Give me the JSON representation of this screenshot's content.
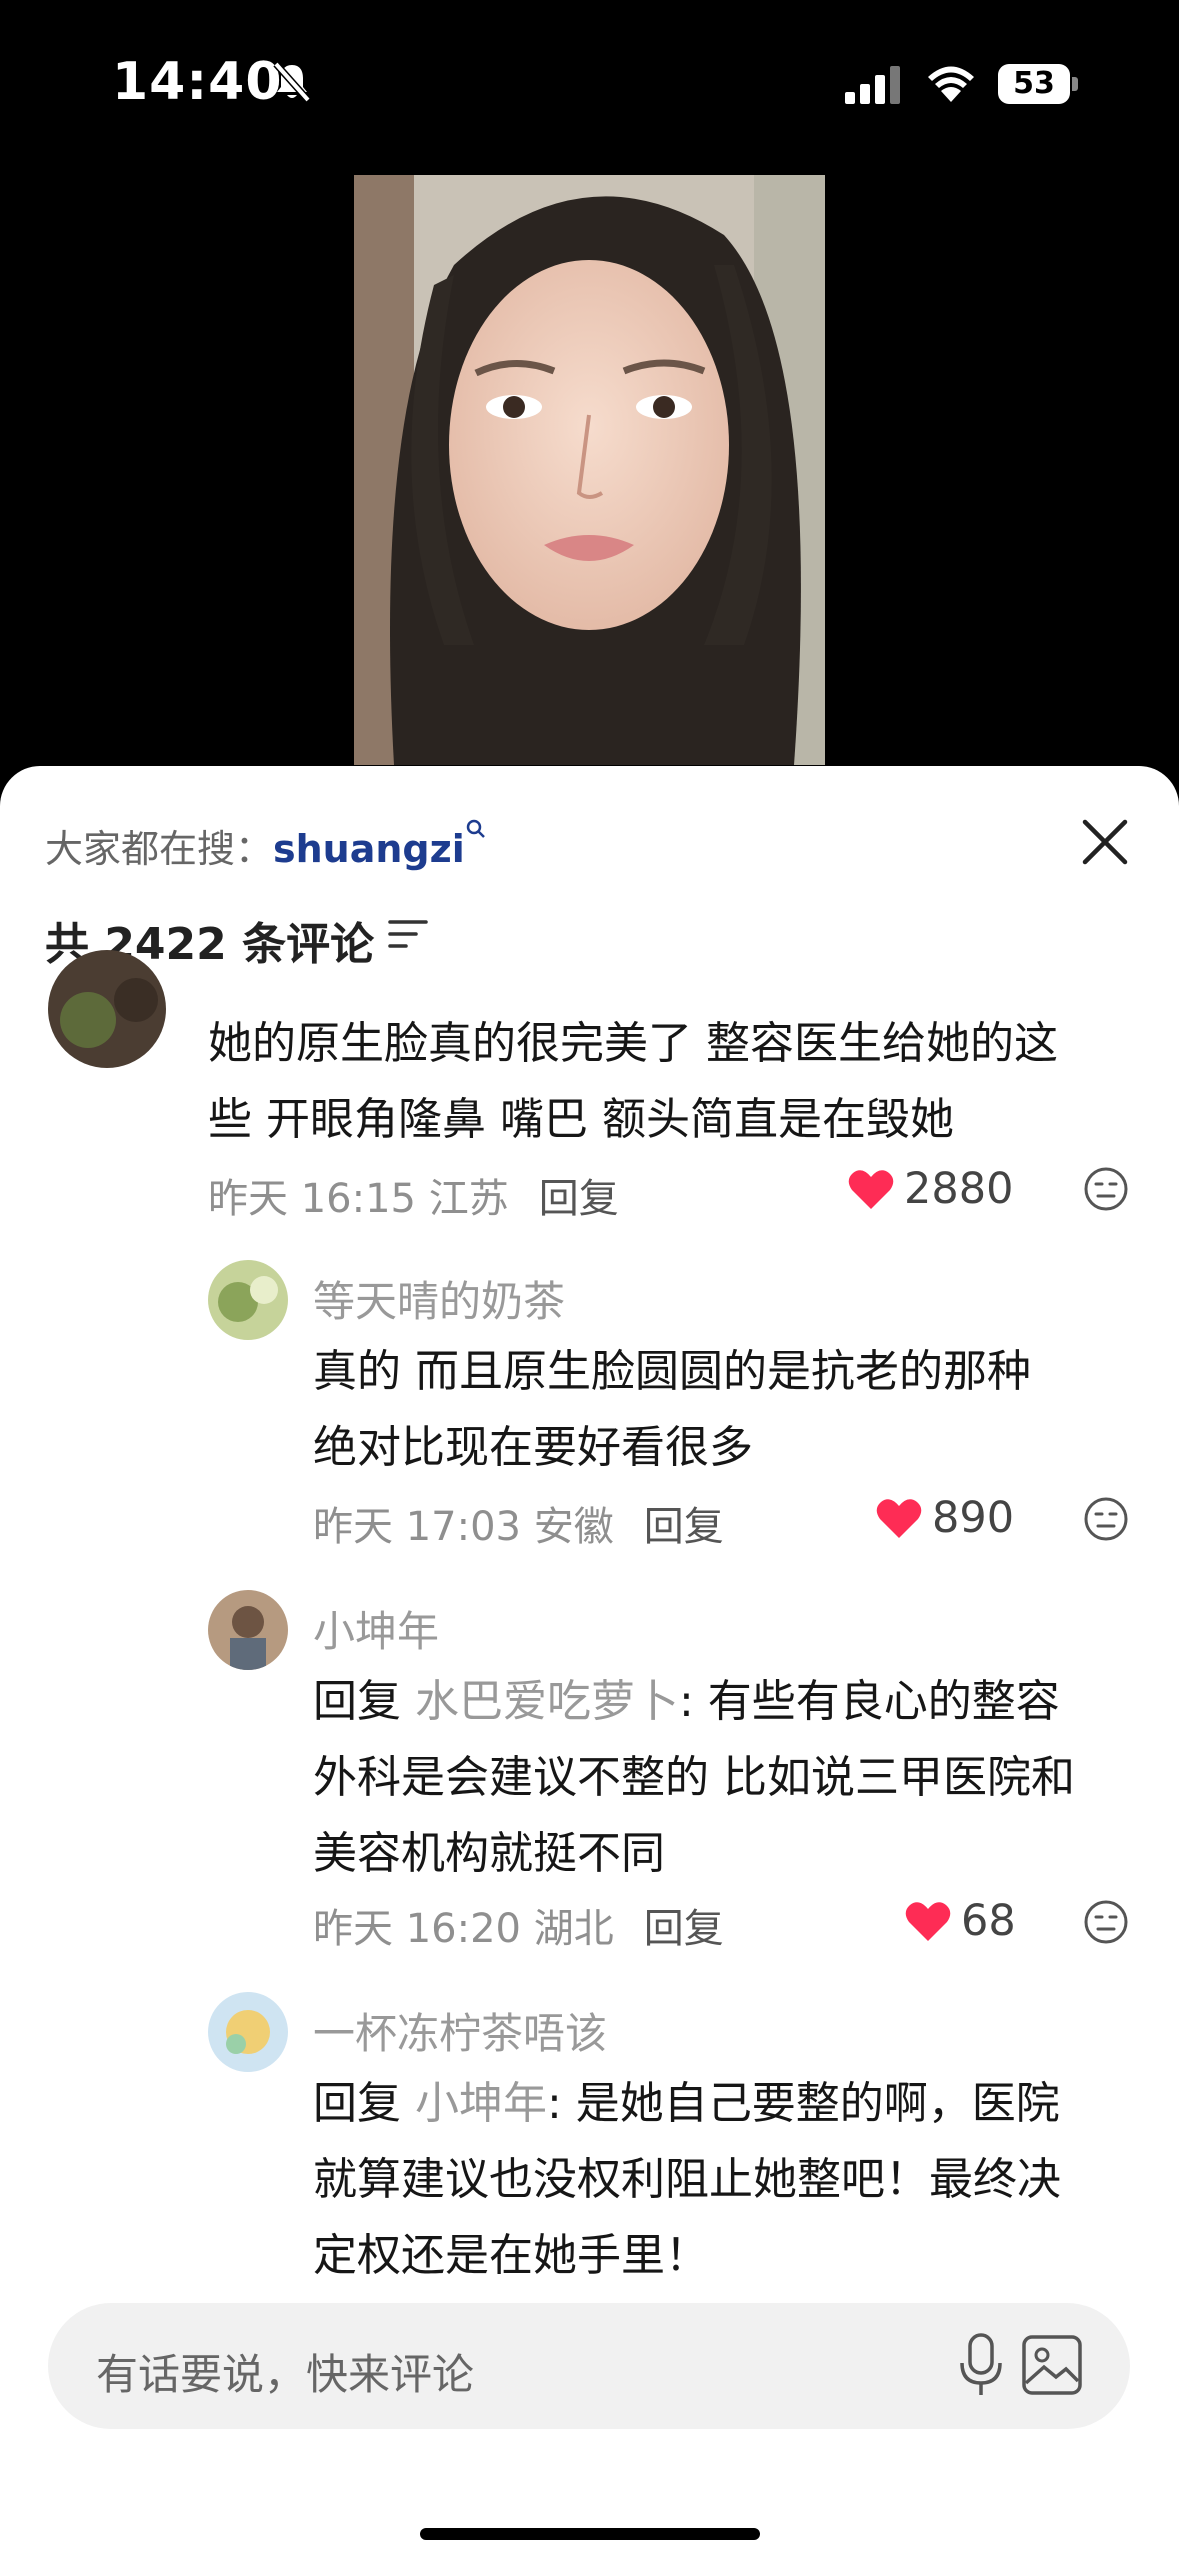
{
  "status_bar": {
    "time": "14:40",
    "battery": "53"
  },
  "sheet": {
    "search_prefix": "大家都在搜：",
    "search_keyword": "shuangzi",
    "comment_count": "共 2422 条评论"
  },
  "comments": [
    {
      "text_line1": "她的原生脸真的很完美了 整容医生给她的这",
      "text_line2": "些 开眼角隆鼻 嘴巴 额头简直是在毁她",
      "time": "昨天 16:15 江苏",
      "reply": "回复",
      "likes": "2880"
    },
    {
      "user": "等天晴的奶茶",
      "text_line1": "真的 而且原生脸圆圆的是抗老的那种",
      "text_line2": "绝对比现在要好看很多",
      "time": "昨天 17:03 安徽",
      "reply": "回复",
      "likes": "890"
    },
    {
      "user": "小坤年",
      "reply_prefix": "回复",
      "mention": "水巴爱吃萝卜",
      "text_line1": ": 有些有良心的整容",
      "text_line2": "外科是会建议不整的 比如说三甲医院和",
      "text_line3": "美容机构就挺不同",
      "time": "昨天 16:20 湖北",
      "reply": "回复",
      "likes": "68"
    },
    {
      "user": "一杯冻柠茶唔该",
      "reply_prefix": "回复",
      "mention": "小坤年",
      "text_line1": ": 是她自己要整的啊，医院",
      "text_line2": "就算建议也没权利阻止她整吧！最终决",
      "text_line3": "定权还是在她手里！"
    }
  ],
  "input": {
    "placeholder": "有话要说，快来评论"
  },
  "colors": {
    "like_red": "#fe2c55",
    "keyword_blue": "#1d3c8f"
  }
}
